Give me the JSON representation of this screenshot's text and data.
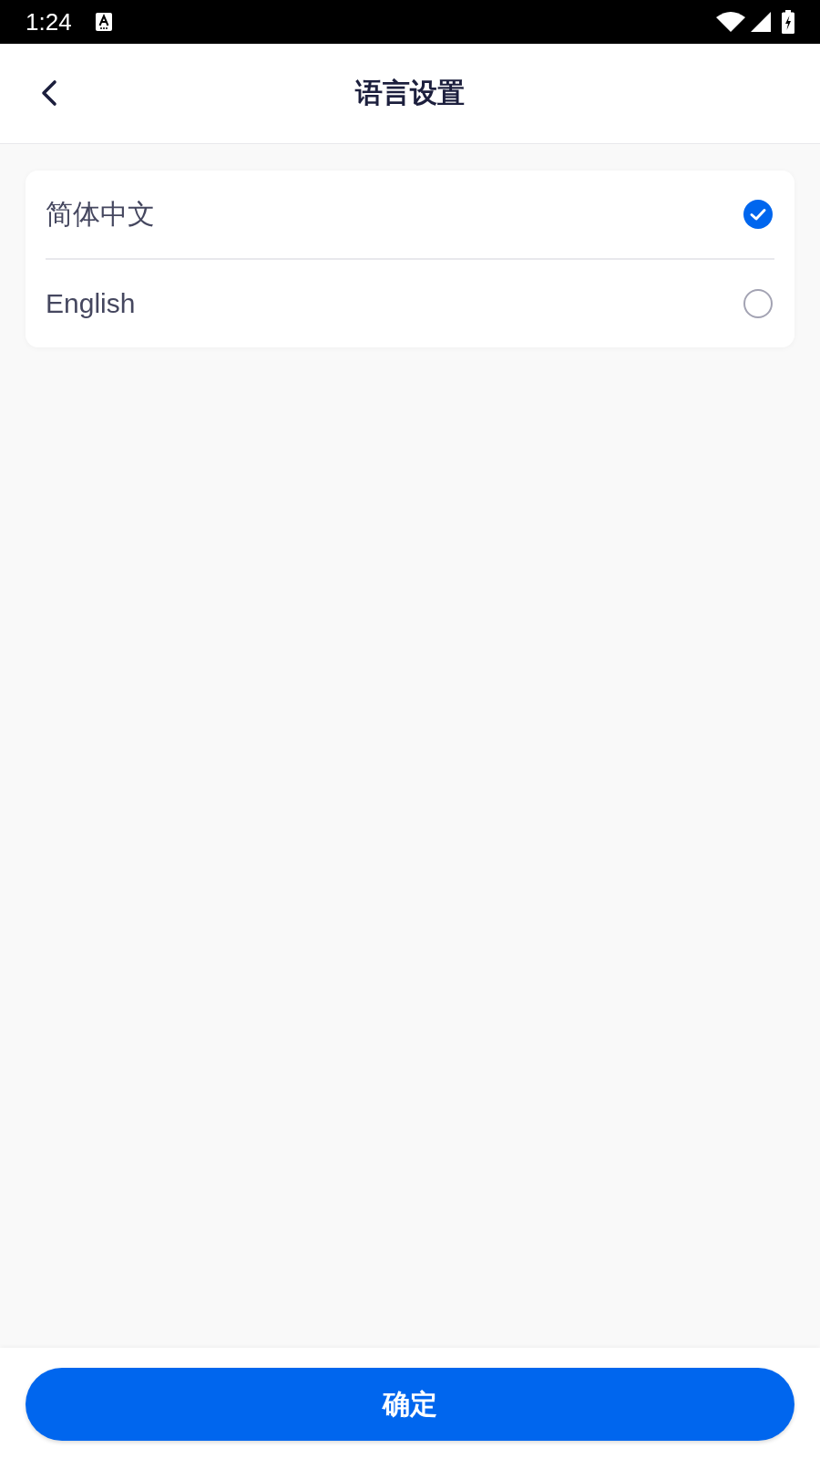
{
  "status_bar": {
    "time": "1:24"
  },
  "header": {
    "title": "语言设置"
  },
  "languages": [
    {
      "label": "简体中文",
      "selected": true
    },
    {
      "label": "English",
      "selected": false
    }
  ],
  "confirm_button": {
    "label": "确定"
  }
}
